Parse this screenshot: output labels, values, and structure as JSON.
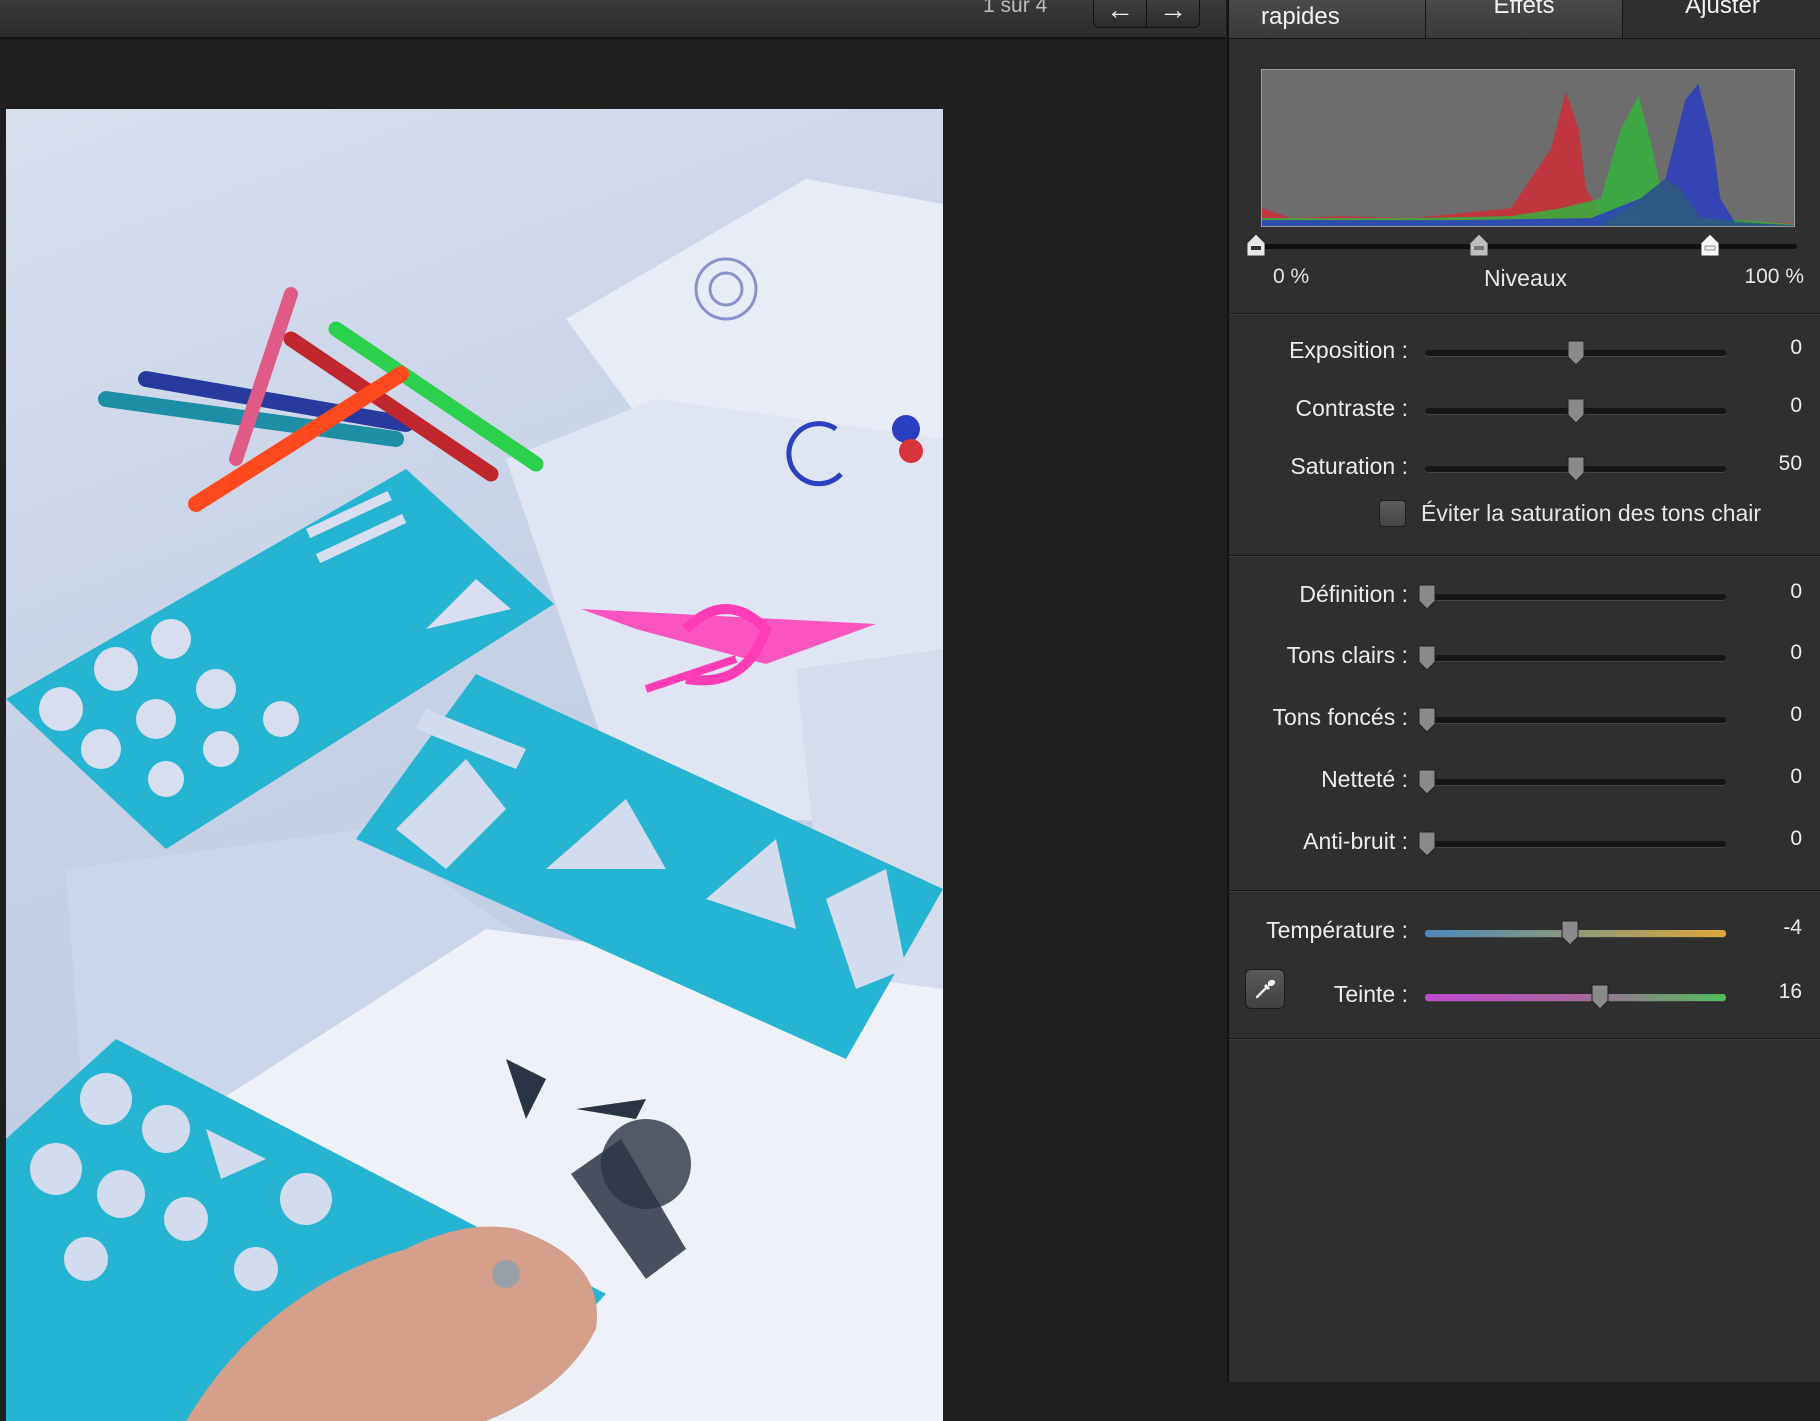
{
  "viewer": {
    "counter": "1 sur 4",
    "nav": {
      "prev_icon": "arrow-left-icon",
      "next_icon": "arrow-right-icon"
    }
  },
  "tabs": [
    {
      "label": "rapides",
      "selected": false
    },
    {
      "label": "Effets",
      "selected": false
    },
    {
      "label": "Ajuster",
      "selected": true
    }
  ],
  "levels": {
    "title": "Niveaux",
    "min_label": "0 %",
    "max_label": "100 %"
  },
  "adjustments": [
    {
      "label": "Exposition :",
      "value": "0"
    },
    {
      "label": "Contraste :",
      "value": "0"
    },
    {
      "label": "Saturation :",
      "value": "50"
    }
  ],
  "skin_tones": {
    "label": "Éviter la saturation des tons chair",
    "checked": false
  },
  "details": [
    {
      "label": "Définition :",
      "value": "0"
    },
    {
      "label": "Tons clairs :",
      "value": "0"
    },
    {
      "label": "Tons foncés :",
      "value": "0"
    },
    {
      "label": "Netteté :",
      "value": "0"
    },
    {
      "label": "Anti-bruit :",
      "value": "0"
    }
  ],
  "color": [
    {
      "label": "Température :",
      "value": "-4"
    },
    {
      "label": "Teinte :",
      "value": "16"
    }
  ],
  "colors": {
    "panel_bg": "#2f2f2f",
    "histogram_red": "#c8303a",
    "histogram_green": "#35b23c",
    "histogram_blue": "#2a3ec0",
    "stencil": "#25b4d2",
    "marker_pink": "#ff3bb5"
  },
  "icons": {
    "eyedropper": "eyedropper-icon"
  }
}
